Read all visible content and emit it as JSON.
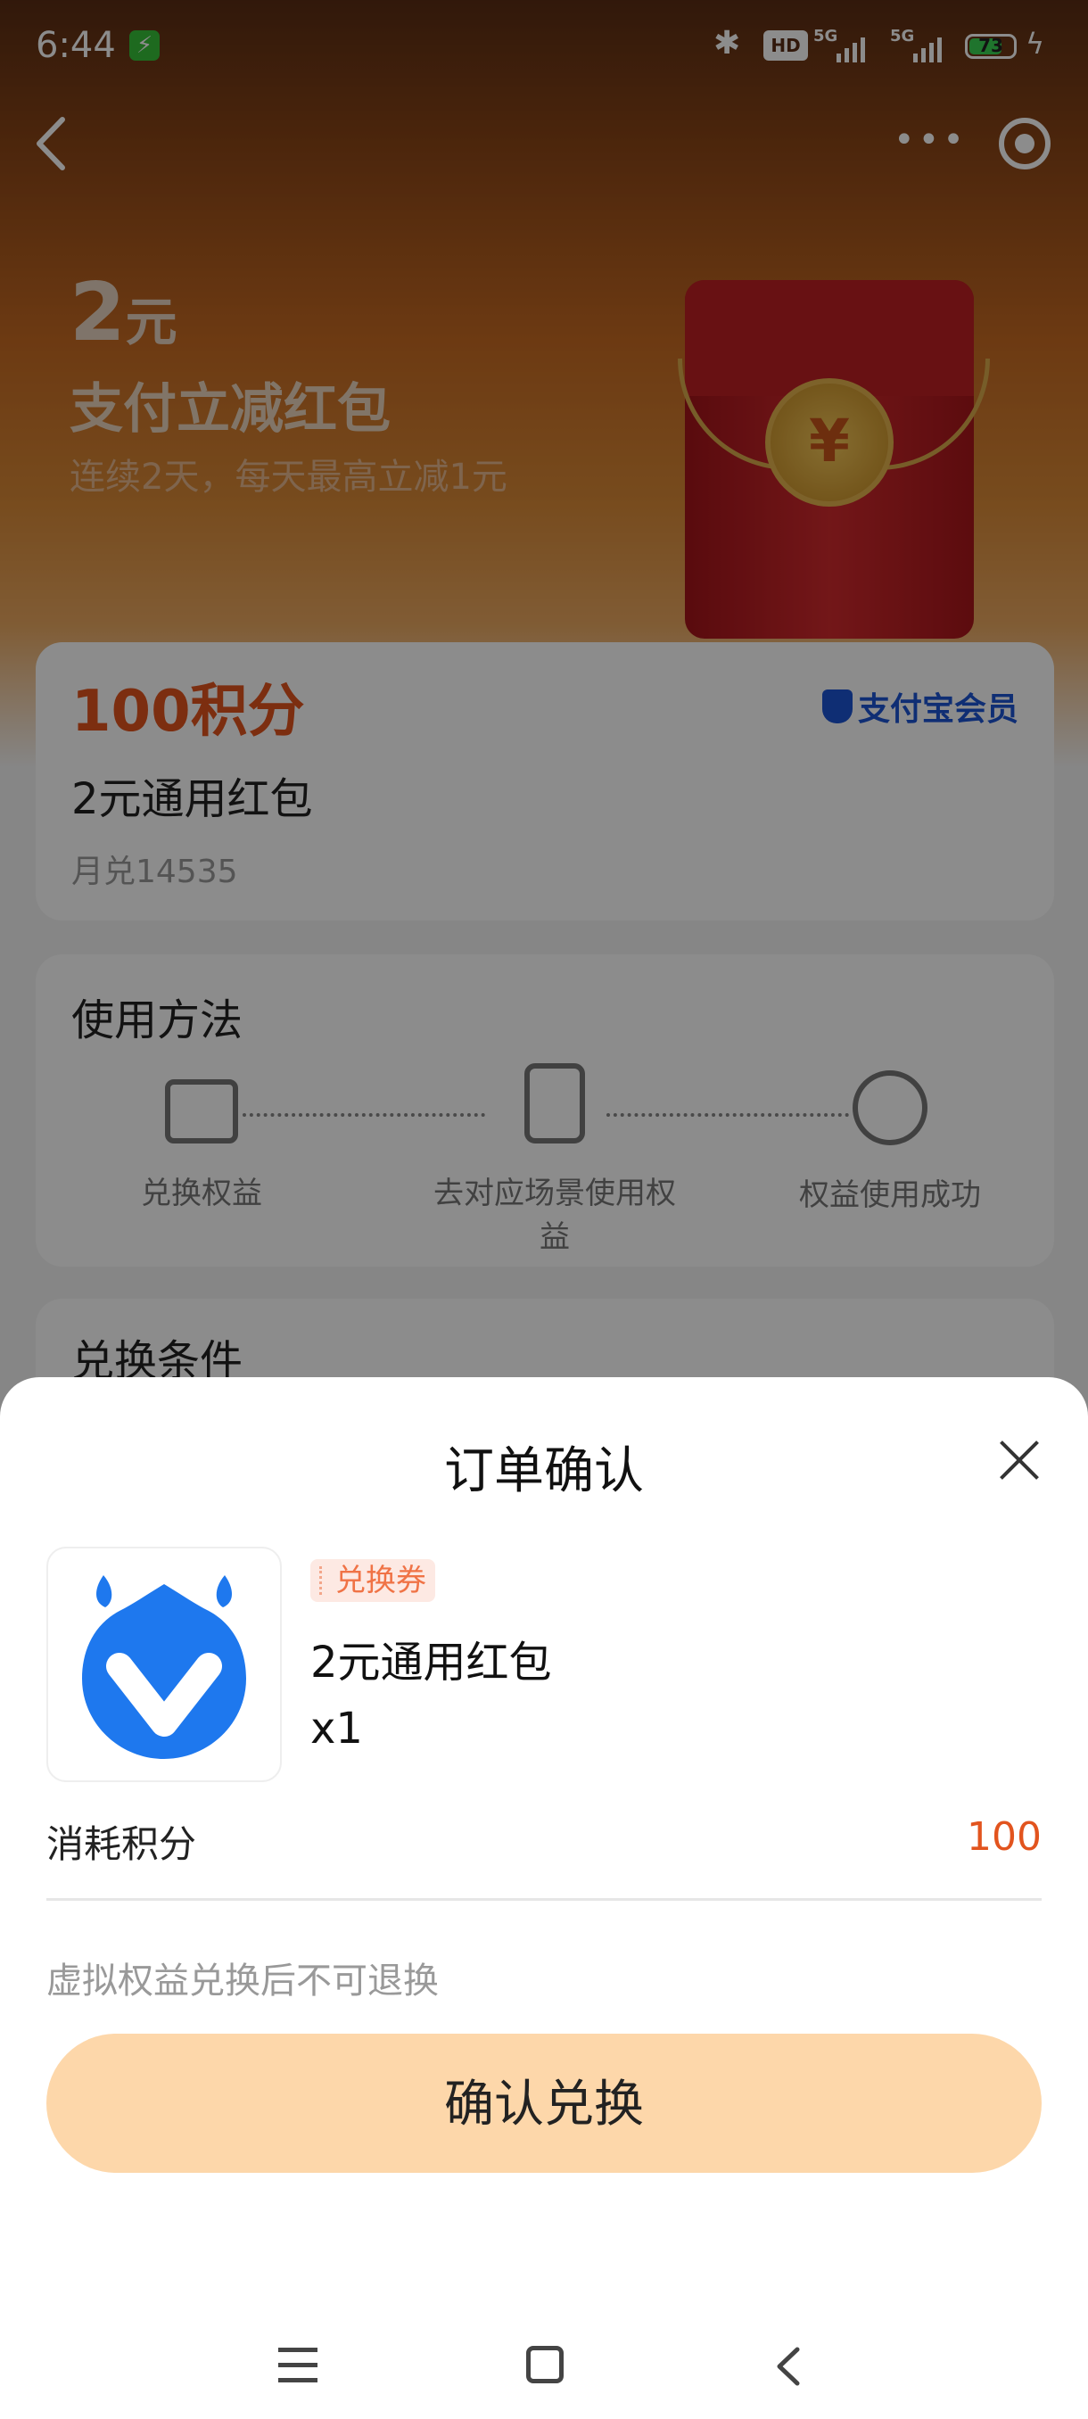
{
  "status_bar": {
    "time": "6:44",
    "charge_icon": "charging-app-icon",
    "hd": "HD",
    "net1": "5G",
    "net2": "5G",
    "battery": "73"
  },
  "hero": {
    "amount": "2",
    "amount_unit": "元",
    "title": "支付立减红包",
    "subtitle": "连续2天，每天最高立减1元"
  },
  "product_card": {
    "points": "100积分",
    "brand": "支付宝会员",
    "name": "2元通用红包",
    "monthly": "月兑14535"
  },
  "usage": {
    "title": "使用方法",
    "steps": [
      "兑换权益",
      "去对应场景使用权益",
      "权益使用成功"
    ]
  },
  "conditions": {
    "title": "兑换条件"
  },
  "sheet": {
    "title": "订单确认",
    "badge": "兑换券",
    "item_name": "2元通用红包",
    "quantity": "x1",
    "cost_label": "消耗积分",
    "cost_value": "100",
    "notice": "虚拟权益兑换后不可退换",
    "confirm_button": "确认兑换"
  },
  "colors": {
    "accent": "#e2541e",
    "button": "#fdd7aa",
    "logo_blue": "#1e78ee"
  }
}
